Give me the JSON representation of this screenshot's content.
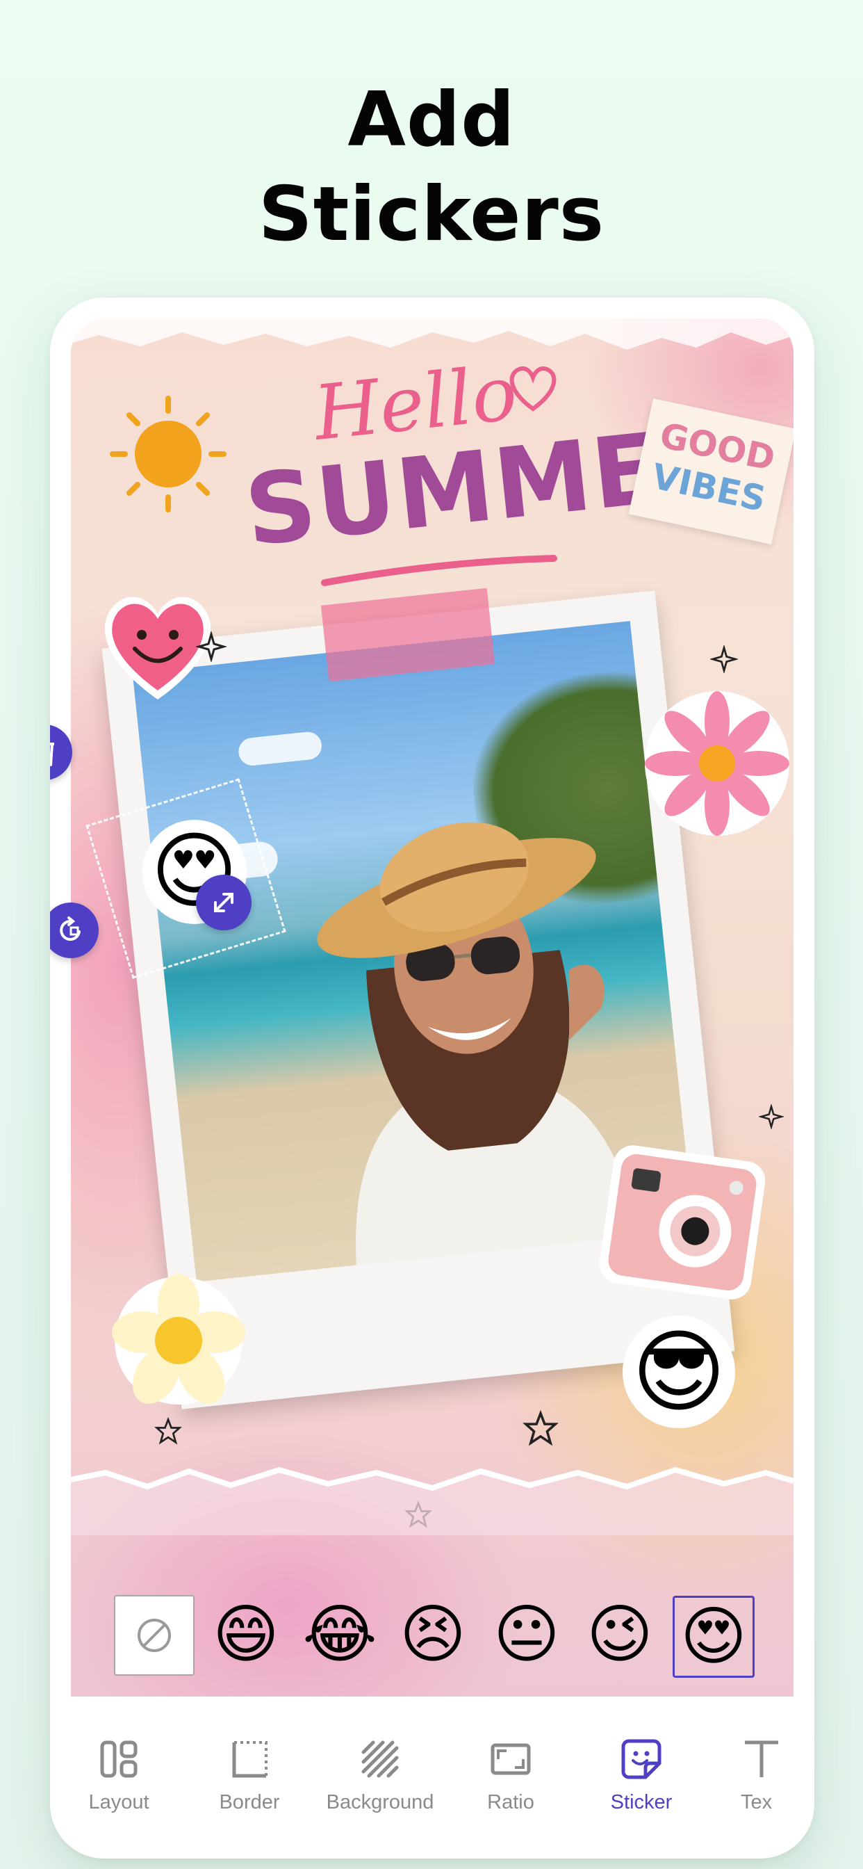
{
  "headline": {
    "line1": "Add",
    "line2": "Stickers"
  },
  "canvas": {
    "hello": "Hello",
    "summer": "SUMMER",
    "good": "GOOD",
    "vibes": "VIBES"
  },
  "tray": {
    "items": [
      {
        "name": "none",
        "glyph": "⊘"
      },
      {
        "name": "grinning",
        "glyph": "😄"
      },
      {
        "name": "joy",
        "glyph": "😂"
      },
      {
        "name": "sad",
        "glyph": "😣"
      },
      {
        "name": "neutral",
        "glyph": "😐"
      },
      {
        "name": "wink",
        "glyph": "😉"
      },
      {
        "name": "heart-eyes",
        "glyph": "😍"
      }
    ],
    "selected": "heart-eyes"
  },
  "tabs": [
    {
      "label": "Layout",
      "icon": "layout-icon"
    },
    {
      "label": "Border",
      "icon": "border-icon"
    },
    {
      "label": "Background",
      "icon": "background-icon"
    },
    {
      "label": "Ratio",
      "icon": "ratio-icon"
    },
    {
      "label": "Sticker",
      "icon": "sticker-icon",
      "active": true
    },
    {
      "label": "Tex",
      "icon": "text-icon"
    }
  ],
  "colors": {
    "accent": "#4f3fc4",
    "page_bg": "#eafbf0",
    "tab_inactive": "#8a8a8a"
  }
}
